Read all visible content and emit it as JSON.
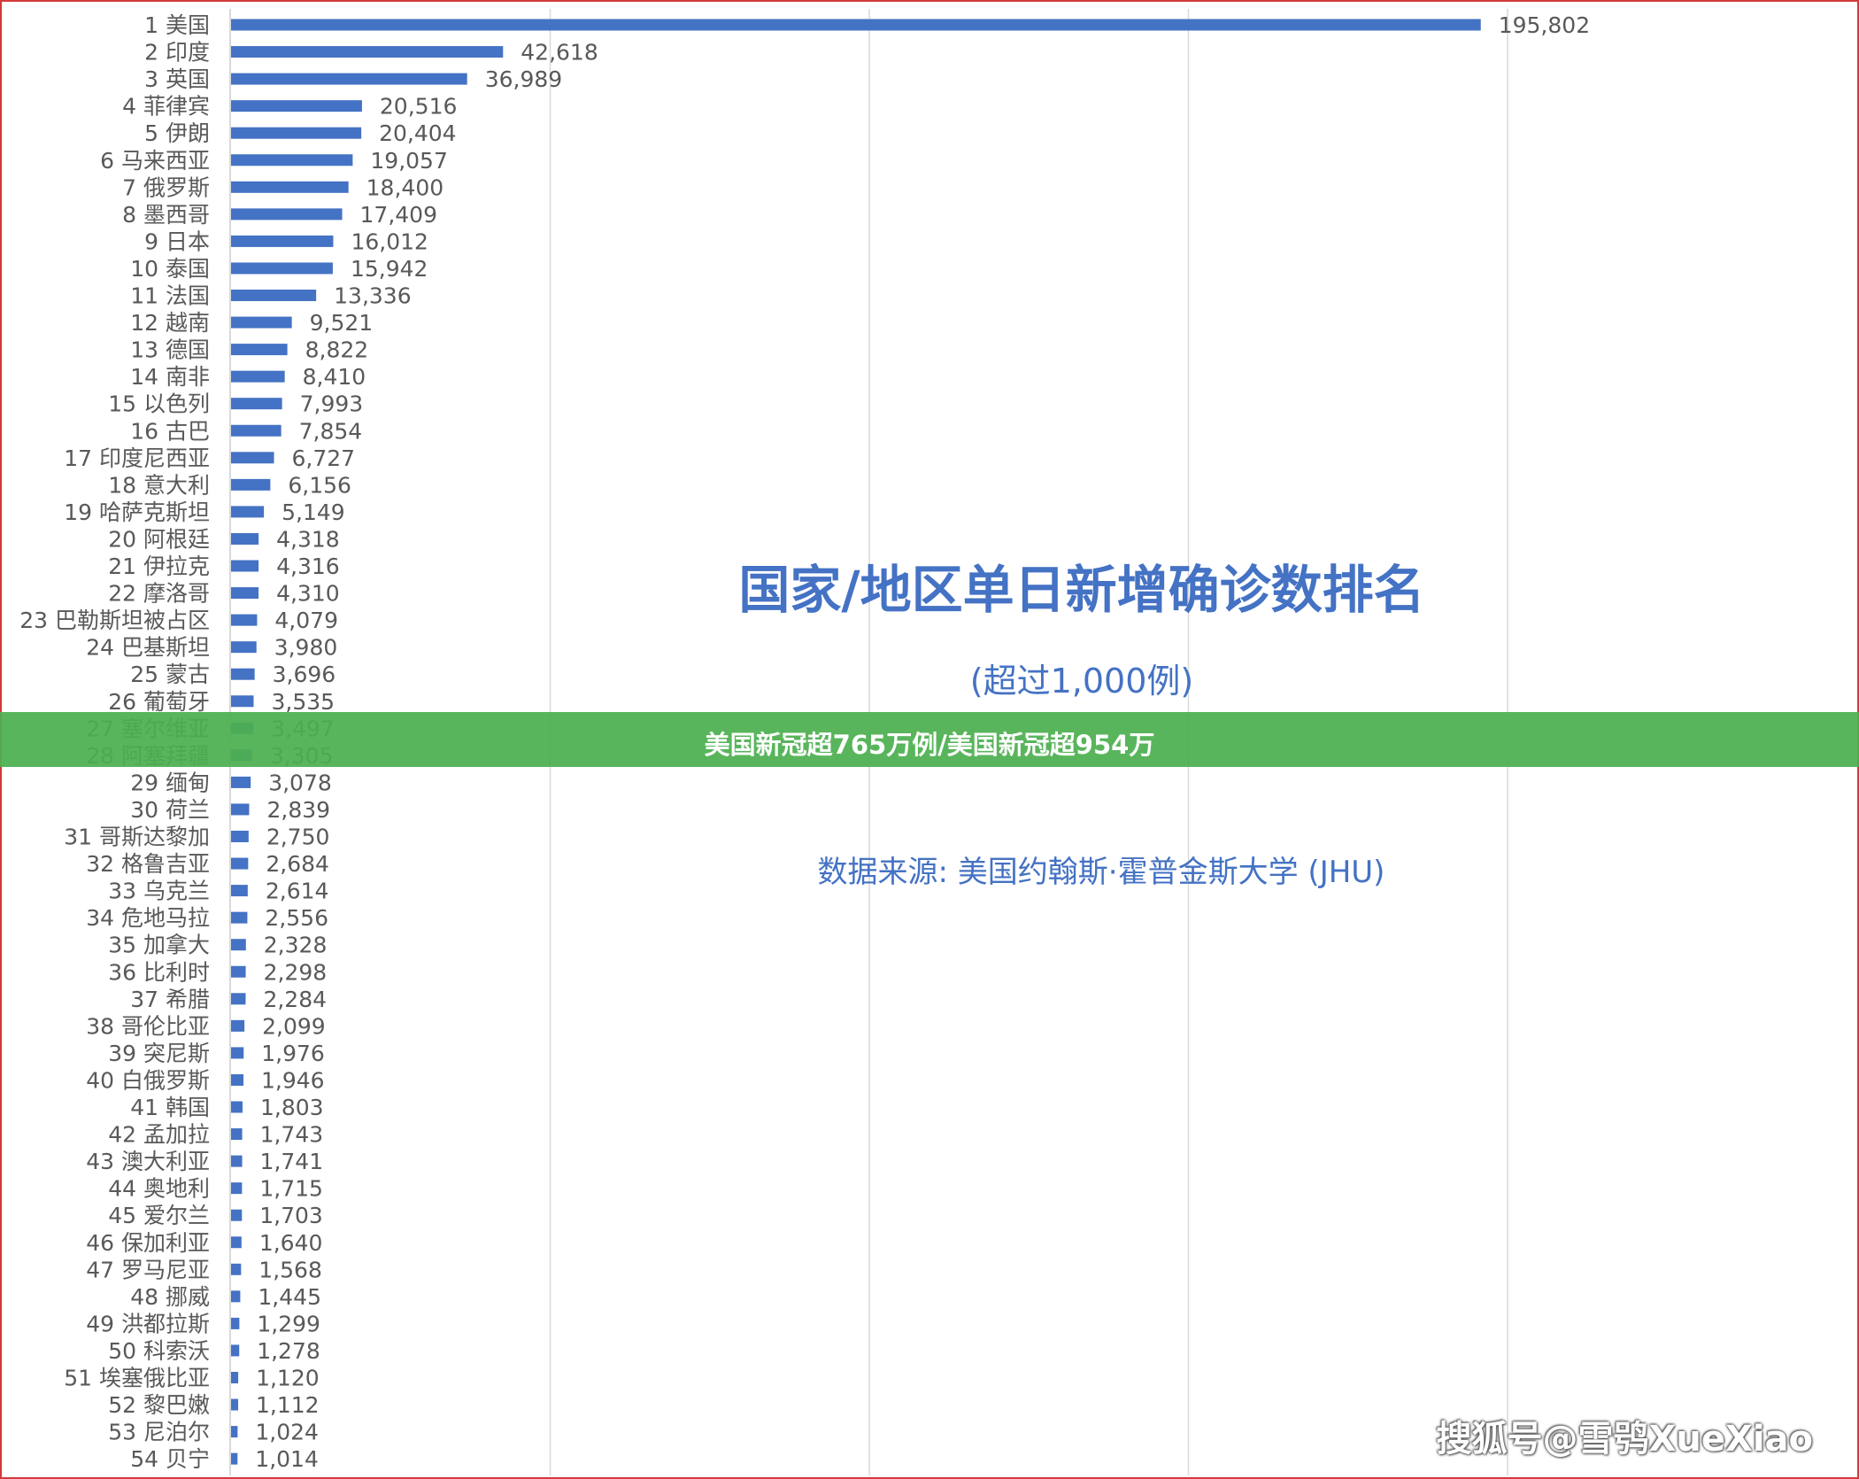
{
  "chart_data": {
    "type": "bar",
    "orientation": "horizontal",
    "title": "国家/地区单日新增确诊数排名",
    "subtitle": "(超过1,000例)",
    "source": "数据来源:  美国约翰斯·霍普金斯大学 (JHU)",
    "xlim": [
      0,
      200000
    ],
    "grid": true,
    "bar_color": "#4472c4",
    "categories": [
      "1 美国",
      "2 印度",
      "3 英国",
      "4 菲律宾",
      "5 伊朗",
      "6 马来西亚",
      "7 俄罗斯",
      "8 墨西哥",
      "9 日本",
      "10 泰国",
      "11 法国",
      "12 越南",
      "13 德国",
      "14 南非",
      "15 以色列",
      "16 古巴",
      "17 印度尼西亚",
      "18 意大利",
      "19 哈萨克斯坦",
      "20 阿根廷",
      "21 伊拉克",
      "22 摩洛哥",
      "23 巴勒斯坦被占区",
      "24 巴基斯坦",
      "25 蒙古",
      "26 葡萄牙",
      "27 塞尔维亚",
      "28 阿塞拜疆",
      "29 缅甸",
      "30 荷兰",
      "31 哥斯达黎加",
      "32 格鲁吉亚",
      "33 乌克兰",
      "34 危地马拉",
      "35 加拿大",
      "36 比利时",
      "37 希腊",
      "38 哥伦比亚",
      "39 突尼斯",
      "40 白俄罗斯",
      "41 韩国",
      "42 孟加拉",
      "43 澳大利亚",
      "44 奥地利",
      "45 爱尔兰",
      "46 保加利亚",
      "47 罗马尼亚",
      "48 挪威",
      "49 洪都拉斯",
      "50 科索沃",
      "51 埃塞俄比亚",
      "52 黎巴嫩",
      "53 尼泊尔",
      "54 贝宁"
    ],
    "values": [
      195802,
      42618,
      36989,
      20516,
      20404,
      19057,
      18400,
      17409,
      16012,
      15942,
      13336,
      9521,
      8822,
      8410,
      7993,
      7854,
      6727,
      6156,
      5149,
      4318,
      4316,
      4310,
      4079,
      3980,
      3696,
      3535,
      3497,
      3305,
      3078,
      2839,
      2750,
      2684,
      2614,
      2556,
      2328,
      2298,
      2284,
      2099,
      1976,
      1946,
      1803,
      1743,
      1741,
      1715,
      1703,
      1640,
      1568,
      1445,
      1299,
      1278,
      1120,
      1112,
      1024,
      1014
    ],
    "value_labels": [
      "195,802",
      "42,618",
      "36,989",
      "20,516",
      "20,404",
      "19,057",
      "18,400",
      "17,409",
      "16,012",
      "15,942",
      "13,336",
      "9,521",
      "8,822",
      "8,410",
      "7,993",
      "7,854",
      "6,727",
      "6,156",
      "5,149",
      "4,318",
      "4,316",
      "4,310",
      "4,079",
      "3,980",
      "3,696",
      "3,535",
      "3,497",
      "3,305",
      "3,078",
      "2,839",
      "2,750",
      "2,684",
      "2,614",
      "2,556",
      "2,328",
      "2,298",
      "2,284",
      "2,099",
      "1,976",
      "1,946",
      "1,803",
      "1,743",
      "1,741",
      "1,715",
      "1,703",
      "1,640",
      "1,568",
      "1,445",
      "1,299",
      "1,278",
      "1,120",
      "1,112",
      "1,024",
      "1,014"
    ]
  },
  "banner": {
    "text": "美国新冠超765万例/美国新冠超954万",
    "color": "#4caf50"
  },
  "watermark": {
    "text": "搜狐号@雪鸮XueXiao"
  },
  "frame_color": "#d23a3a"
}
